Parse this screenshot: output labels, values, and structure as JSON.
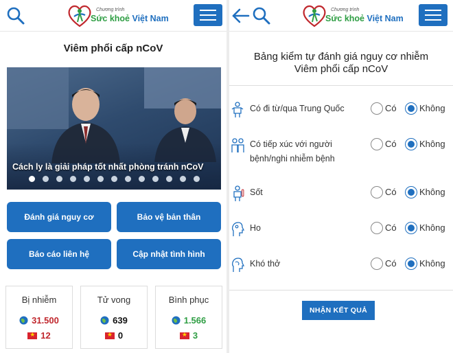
{
  "colors": {
    "brand_blue": "#1f6fbf",
    "brand_green": "#2f9e44",
    "infected_red": "#c0272d",
    "death_black": "#111111",
    "recovered_green": "#2f9e44"
  },
  "logo": {
    "small": "Chương trình",
    "main_1": "Sức khoẻ ",
    "main_2": "Việt Nam"
  },
  "left": {
    "title": "Viêm phổi cấp nCoV",
    "banner_caption": "Cách ly là giải pháp tốt nhất phòng tránh nCoV",
    "slide_count": 13,
    "active_slide": 1,
    "buttons": {
      "assess": "Đánh giá nguy cơ",
      "protect": "Bảo vệ bản thân",
      "report": "Báo cáo liên hệ",
      "update": "Cập nhật tình hình"
    },
    "stats": [
      {
        "label": "Bị nhiễm",
        "world": "31.500",
        "vn": "12"
      },
      {
        "label": "Tử vong",
        "world": "639",
        "vn": "0"
      },
      {
        "label": "Bình phục",
        "world": "1.566",
        "vn": "3"
      }
    ]
  },
  "right": {
    "title_line1": "Bảng kiểm tự đánh giá nguy cơ nhiễm",
    "title_line2": "Viêm phổi cấp nCoV",
    "questions": [
      {
        "line1": "Có đi từ/qua Trung Quốc",
        "line2": "",
        "icon": "traveler-icon",
        "yes": "Có",
        "no": "Không",
        "selected": "no"
      },
      {
        "line1": "Có tiếp xúc với người",
        "line2": "bệnh/nghi nhiễm bệnh",
        "icon": "contact-icon",
        "yes": "Có",
        "no": "Không",
        "selected": "no"
      },
      {
        "line1": "Sốt",
        "line2": "",
        "icon": "thermometer-person-icon",
        "yes": "Có",
        "no": "Không",
        "selected": "no"
      },
      {
        "line1": "Ho",
        "line2": "",
        "icon": "cough-icon",
        "yes": "Có",
        "no": "Không",
        "selected": "no"
      },
      {
        "line1": "Khó thở",
        "line2": "",
        "icon": "breathing-icon",
        "yes": "Có",
        "no": "Không",
        "selected": "no"
      }
    ],
    "submit": "NHẬN KẾT QUẢ"
  }
}
